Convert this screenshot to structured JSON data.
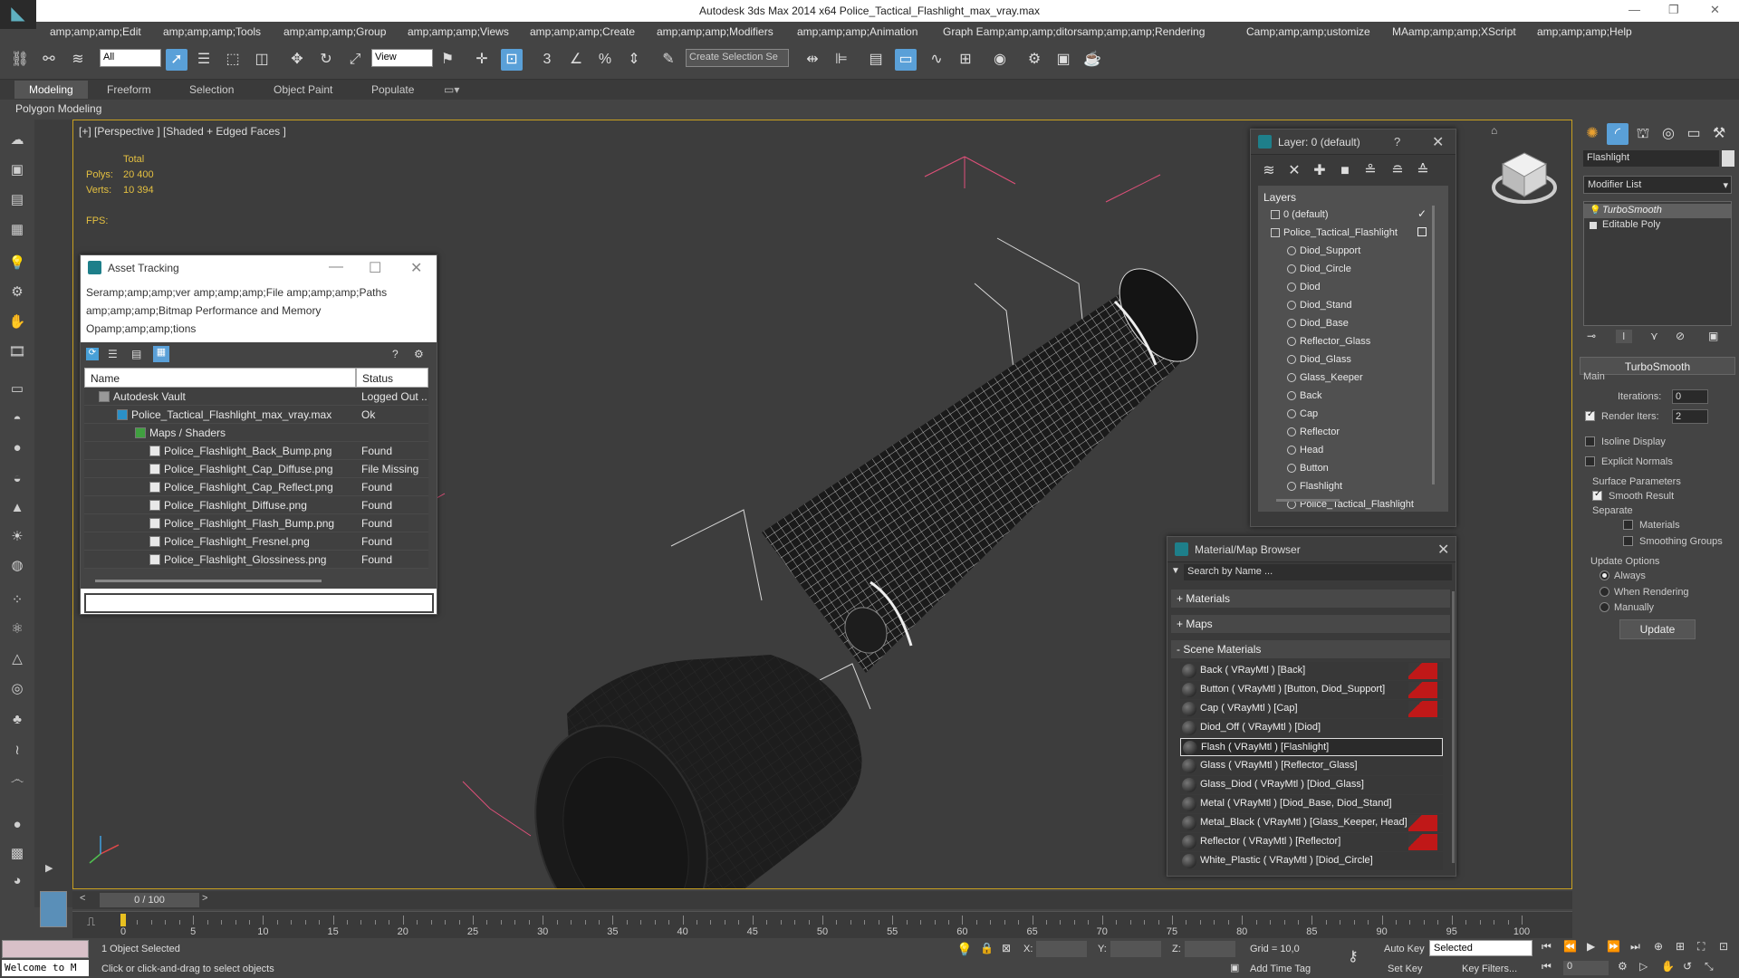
{
  "window": {
    "title": "Autodesk 3ds Max  2014 x64    Police_Tactical_Flashlight_max_vray.max"
  },
  "menu": [
    "amp;amp;amp;Edit",
    "amp;amp;amp;Tools",
    "amp;amp;amp;Group",
    "amp;amp;amp;Views",
    "amp;amp;amp;Create",
    "amp;amp;amp;Modifiers",
    "amp;amp;amp;Animation",
    "Graph Eamp;amp;amp;ditors",
    "amp;amp;amp;Rendering",
    "Camp;amp;amp;ustomize",
    "MAamp;amp;amp;XScript",
    "amp;amp;amp;Help"
  ],
  "toolbar": {
    "filter": "All",
    "refcoord": "View",
    "selset": "Create Selection Se"
  },
  "ribbon": {
    "tabs": [
      "Modeling",
      "Freeform",
      "Selection",
      "Object Paint",
      "Populate"
    ],
    "sub": "Polygon Modeling"
  },
  "viewport": {
    "label": "[+] [Perspective ] [Shaded + Edged Faces ]",
    "stats": {
      "total": "Total",
      "polys_label": "Polys:",
      "polys": "20 400",
      "verts_label": "Verts:",
      "verts": "10 394",
      "fps_label": "FPS:"
    }
  },
  "asset_tracking": {
    "title": "Asset Tracking",
    "menu1": "Seramp;amp;amp;ver     amp;amp;amp;File     amp;amp;amp;Paths",
    "menu2": "amp;amp;amp;Bitmap Performance and Memory",
    "menu3": "Opamp;amp;amp;tions",
    "col_name": "Name",
    "col_status": "Status",
    "rows": [
      {
        "name": "Autodesk Vault",
        "status": "Logged Out ..."
      },
      {
        "name": "Police_Tactical_Flashlight_max_vray.max",
        "status": "Ok"
      },
      {
        "name": "Maps / Shaders",
        "status": ""
      },
      {
        "name": "Police_Flashlight_Back_Bump.png",
        "status": "Found"
      },
      {
        "name": "Police_Flashlight_Cap_Diffuse.png",
        "status": "File Missing"
      },
      {
        "name": "Police_Flashlight_Cap_Reflect.png",
        "status": "Found"
      },
      {
        "name": "Police_Flashlight_Diffuse.png",
        "status": "Found"
      },
      {
        "name": "Police_Flashlight_Flash_Bump.png",
        "status": "Found"
      },
      {
        "name": "Police_Flashlight_Fresnel.png",
        "status": "Found"
      },
      {
        "name": "Police_Flashlight_Glossiness.png",
        "status": "Found"
      }
    ]
  },
  "layers": {
    "title": "Layer: 0 (default)",
    "q": "?",
    "header": "Layers",
    "items": [
      "0 (default)",
      "Police_Tactical_Flashlight",
      "Diod_Support",
      "Diod_Circle",
      "Diod",
      "Diod_Stand",
      "Diod_Base",
      "Reflector_Glass",
      "Diod_Glass",
      "Glass_Keeper",
      "Back",
      "Cap",
      "Reflector",
      "Head",
      "Button",
      "Flashlight",
      "Police_Tactical_Flashlight"
    ]
  },
  "material_browser": {
    "title": "Material/Map Browser",
    "search": "Search by Name ...",
    "groups": [
      "+ Materials",
      "+ Maps",
      "- Scene Materials"
    ],
    "items": [
      {
        "label": "Back  ( VRayMtl )  [Back]",
        "flag": true
      },
      {
        "label": "Button  ( VRayMtl )  [Button, Diod_Support]",
        "flag": true
      },
      {
        "label": "Cap  ( VRayMtl )  [Cap]",
        "flag": true
      },
      {
        "label": "Diod_Off  ( VRayMtl )  [Diod]",
        "flag": false
      },
      {
        "label": "Flash  ( VRayMtl )  [Flashlight]",
        "flag": false
      },
      {
        "label": "Glass  ( VRayMtl )  [Reflector_Glass]",
        "flag": false
      },
      {
        "label": "Glass_Diod  ( VRayMtl )  [Diod_Glass]",
        "flag": false
      },
      {
        "label": "Metal  ( VRayMtl )  [Diod_Base, Diod_Stand]",
        "flag": false
      },
      {
        "label": "Metal_Black  ( VRayMtl )  [Glass_Keeper, Head]",
        "flag": true
      },
      {
        "label": "Reflector  ( VRayMtl )  [Reflector]",
        "flag": true
      },
      {
        "label": "White_Plastic  ( VRayMtl )  [Diod_Circle]",
        "flag": false
      }
    ]
  },
  "command_panel": {
    "object_name": "Flashlight",
    "modifier_list": "Modifier List",
    "stack": [
      "TurboSmooth",
      "Editable Poly"
    ],
    "rollout": "TurboSmooth",
    "main": "Main",
    "iterations_label": "Iterations:",
    "iterations": "0",
    "render_iters_label": "Render Iters:",
    "render_iters": "2",
    "isoline": "Isoline Display",
    "explicit": "Explicit Normals",
    "surface": "Surface Parameters",
    "smooth": "Smooth Result",
    "separate": "Separate",
    "materials": "Materials",
    "smoothing": "Smoothing Groups",
    "update_opts": "Update Options",
    "always": "Always",
    "when_rendering": "When Rendering",
    "manually": "Manually",
    "update": "Update"
  },
  "timeline": {
    "frame": "0 / 100",
    "ticks": [
      "0",
      "5",
      "10",
      "15",
      "20",
      "25",
      "30",
      "35",
      "40",
      "45",
      "50",
      "55",
      "60",
      "65",
      "70",
      "75",
      "80",
      "85",
      "90",
      "95",
      "100"
    ]
  },
  "status": {
    "welcome": "Welcome to M",
    "selected": "1 Object Selected",
    "prompt": "Click or click-and-drag to select objects",
    "x": "X:",
    "y": "Y:",
    "z": "Z:",
    "grid": "Grid = 10,0",
    "auto_key": "Auto Key",
    "key_mode": "Selected",
    "set_key": "Set Key",
    "key_filters": "Key Filters...",
    "add_time_tag": "Add Time Tag",
    "frame": "0"
  }
}
